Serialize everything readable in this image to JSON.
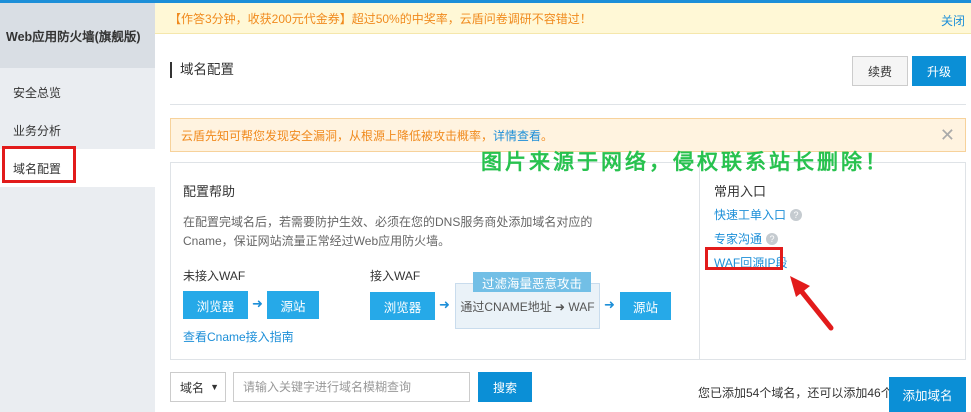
{
  "sidebar": {
    "brand": "Web应用防火墙(旗舰版)",
    "items": [
      {
        "label": "安全总览"
      },
      {
        "label": "业务分析"
      },
      {
        "label": "域名配置"
      }
    ]
  },
  "banner": {
    "text": "【作答3分钟，收获200元代金券】超过50%的中奖率，云盾问卷调研不容错过！",
    "close_label": "关闭"
  },
  "header": {
    "title": "域名配置",
    "renew_label": "续费",
    "upgrade_label": "升级"
  },
  "notice": {
    "text": "云盾先知可帮您发现安全漏洞，从根源上降低被攻击概率，",
    "link": "详情查看",
    "suffix": "。",
    "close": "✕"
  },
  "watermark": "图片来源于网络，侵权联系站长删除！",
  "help": {
    "title": "配置帮助",
    "desc": "在配置完域名后，若需要防护生效、必须在您的DNS服务商处添加域名对应的Cname，保证网站流量正常经过Web应用防火墙。",
    "without_waf_label": "未接入WAF",
    "with_waf_label": "接入WAF",
    "browser": "浏览器",
    "origin": "源站",
    "arrow": "➜",
    "cname_box": "通过CNAME地址 ➜ WAF",
    "filter_label": "过滤海量恶意攻击",
    "guide_link": "查看Cname接入指南"
  },
  "quick": {
    "title": "常用入口",
    "links": [
      {
        "label": "快速工单入口"
      },
      {
        "label": "专家沟通"
      },
      {
        "label": "WAF回源IP段"
      }
    ],
    "help_mark": "?"
  },
  "toolbar": {
    "select_value": "域名",
    "search_placeholder": "请输入关键字进行域名模糊查询",
    "search_label": "搜索",
    "count_text": "您已添加54个域名，还可以添加46个",
    "add_label": "添加域名"
  },
  "colors": {
    "accent": "#0b8fd6",
    "highlight_box": "#e21b1b",
    "watermark": "#28c24f"
  }
}
